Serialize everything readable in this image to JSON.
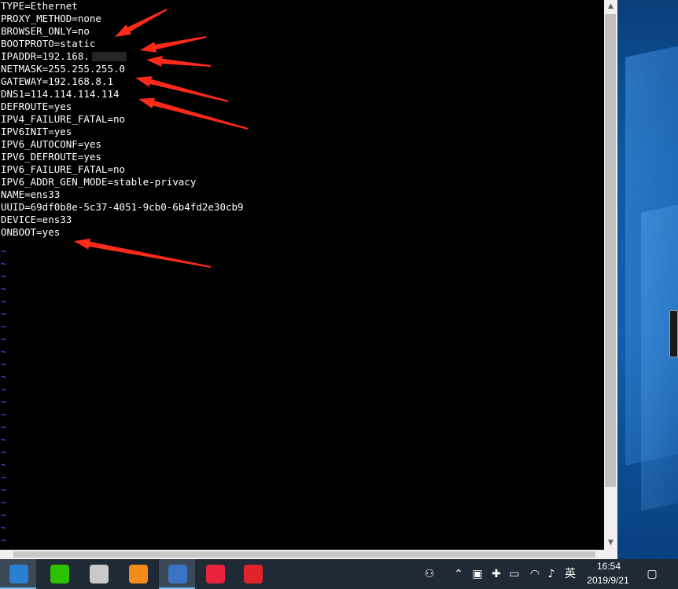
{
  "terminal": {
    "lines": [
      "TYPE=Ethernet",
      "PROXY_METHOD=none",
      "BROWSER_ONLY=no",
      "BOOTPROTO=static",
      "IPADDR=192.168.",
      "NETMASK=255.255.255.0",
      "GATEWAY=192.168.8.1",
      "DNS1=114.114.114.114",
      "DEFROUTE=yes",
      "IPV4_FAILURE_FATAL=no",
      "IPV6INIT=yes",
      "IPV6_AUTOCONF=yes",
      "IPV6_DEFROUTE=yes",
      "IPV6_FAILURE_FATAL=no",
      "IPV6_ADDR_GEN_MODE=stable-privacy",
      "NAME=ens33",
      "UUID=69df0b8e-5c37-4051-9cb0-6b4fd2e30cb9",
      "DEVICE=ens33",
      "ONBOOT=yes"
    ],
    "tilde_char": "~",
    "tilde_count": 24,
    "text_color": "#ffffff",
    "tilde_color": "#3b5cff",
    "annotation_color": "#ff2a1a"
  },
  "scrollbar": {
    "up_arrow": "▲",
    "down_arrow": "▼"
  },
  "taskbar": {
    "apps": [
      {
        "name": "vmware-icon",
        "color": "#2a7fd0"
      },
      {
        "name": "wechat-icon",
        "color": "#2dc100"
      },
      {
        "name": "control-panel-icon",
        "color": "#c9c9c9"
      },
      {
        "name": "colorful-app-icon",
        "color": "#f28b1c"
      },
      {
        "name": "video-player-icon",
        "color": "#3a73c6"
      },
      {
        "name": "xmind-icon",
        "color": "#e8243c"
      },
      {
        "name": "netease-music-icon",
        "color": "#e0242a"
      }
    ],
    "tray": {
      "ime_label": "英",
      "time": "16:54",
      "date": "2019/9/21"
    }
  }
}
